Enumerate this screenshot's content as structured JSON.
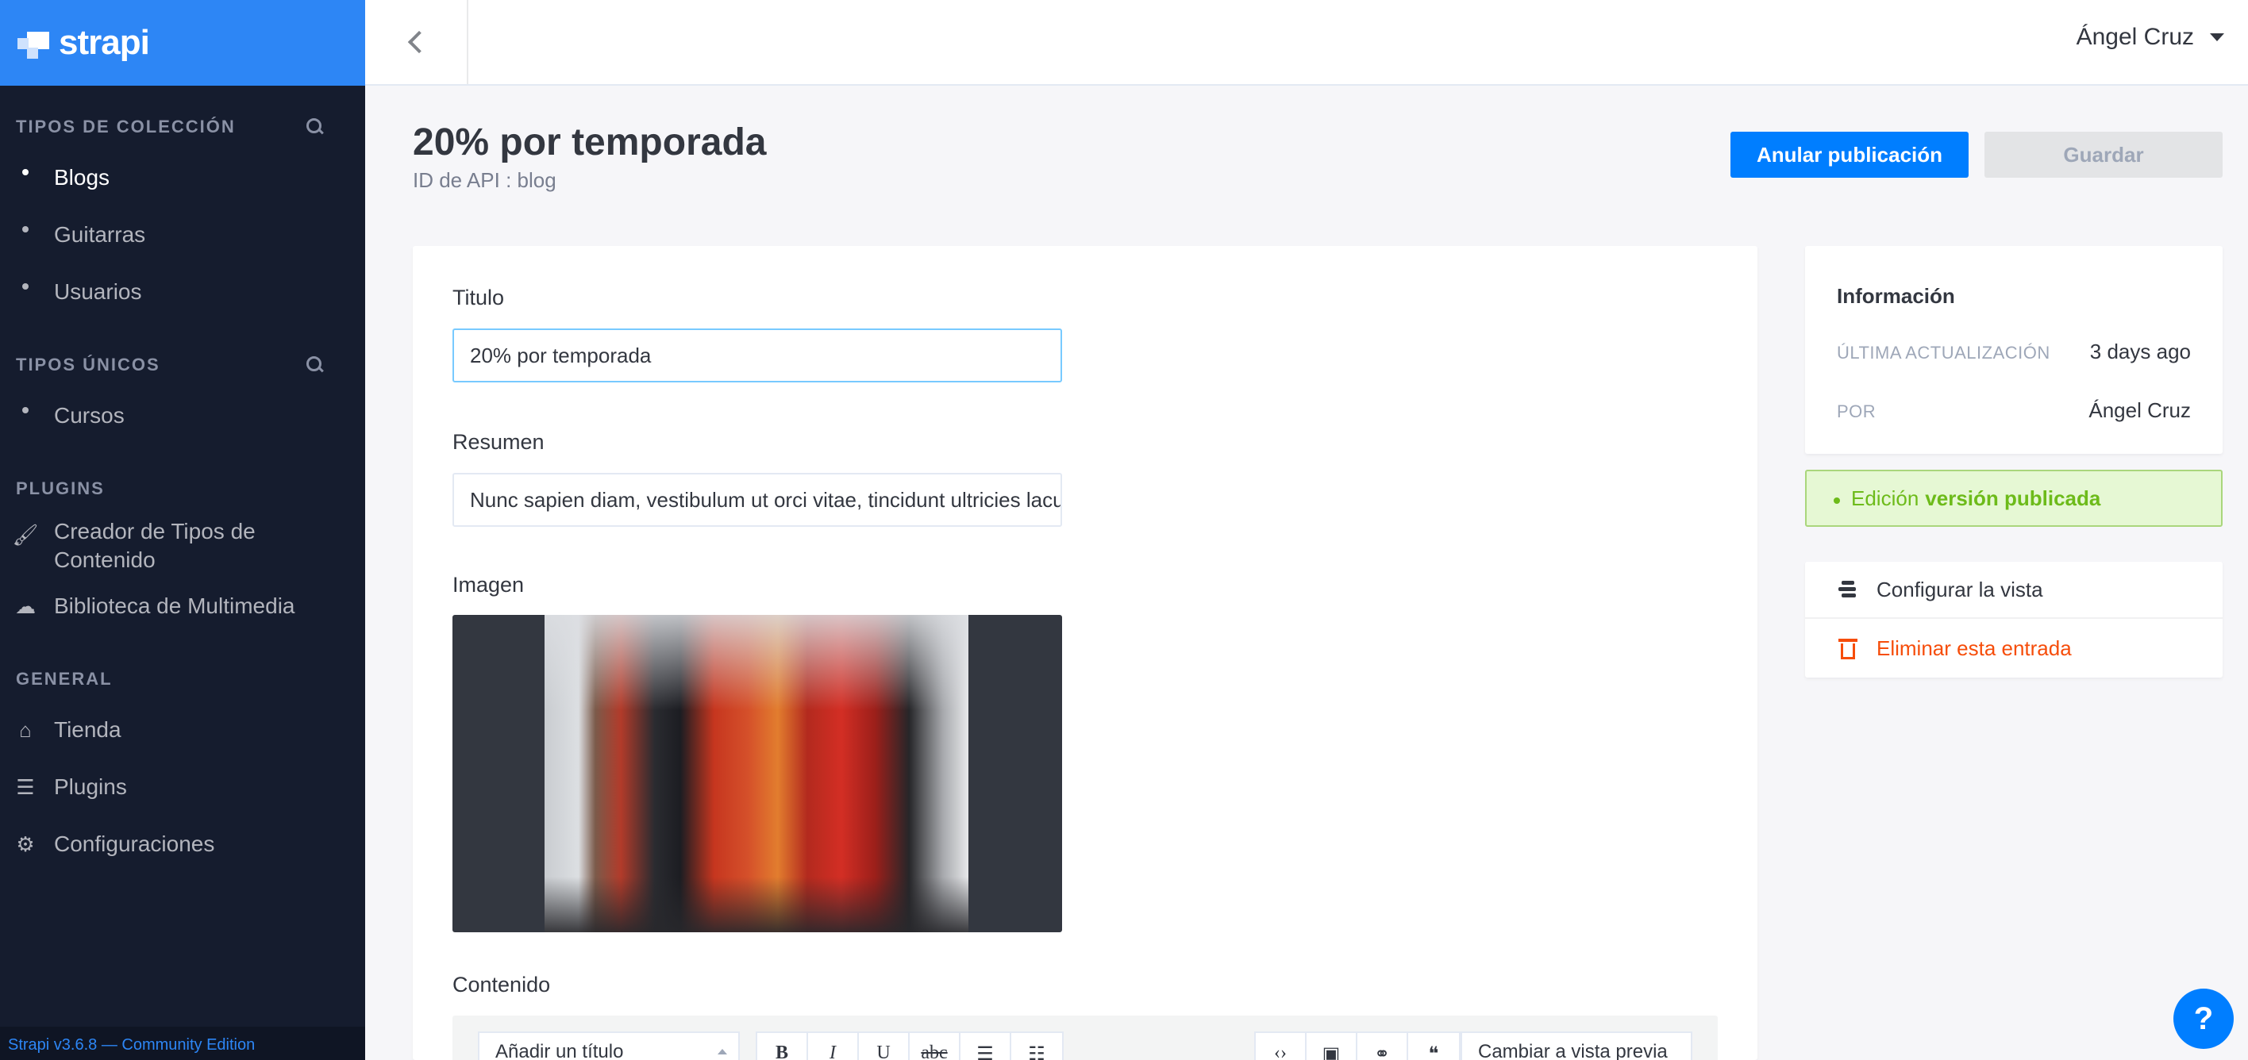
{
  "app": {
    "brand": "strapi",
    "version_footer": "Strapi v3.6.8 — Community Edition"
  },
  "sidebar": {
    "collection_types": {
      "title": "TIPOS DE COLECCIÓN",
      "items": [
        {
          "label": "Blogs",
          "active": true
        },
        {
          "label": "Guitarras",
          "active": false
        },
        {
          "label": "Usuarios",
          "active": false
        }
      ]
    },
    "single_types": {
      "title": "TIPOS ÚNICOS",
      "items": [
        {
          "label": "Cursos"
        }
      ]
    },
    "plugins": {
      "title": "PLUGINS",
      "items": [
        {
          "label": "Creador de Tipos de Contenido",
          "icon": "paintbrush-icon"
        },
        {
          "label": "Biblioteca de Multimedia",
          "icon": "cloud-upload-icon"
        }
      ]
    },
    "general": {
      "title": "GENERAL",
      "items": [
        {
          "label": "Tienda",
          "icon": "basket-icon"
        },
        {
          "label": "Plugins",
          "icon": "list-icon"
        },
        {
          "label": "Configuraciones",
          "icon": "gear-icon"
        }
      ]
    }
  },
  "header": {
    "user": "Ángel Cruz"
  },
  "page": {
    "title": "20% por temporada",
    "api_id": "ID de API : blog",
    "unpublish_label": "Anular publicación",
    "save_label": "Guardar"
  },
  "form": {
    "titulo": {
      "label": "Titulo",
      "value": "20% por temporada"
    },
    "resumen": {
      "label": "Resumen",
      "value": "Nunc sapien diam, vestibulum ut orci vitae, tincidunt ultricies lacus"
    },
    "imagen": {
      "label": "Imagen"
    },
    "contenido": {
      "label": "Contenido",
      "heading_select": "Añadir un título",
      "tools": [
        "B",
        "I",
        "U",
        "abc",
        "ul",
        "ol",
        "code",
        "image",
        "link",
        "quote"
      ],
      "preview_label": "Cambiar a vista previa"
    }
  },
  "info": {
    "title": "Información",
    "last_update_key": "ÚLTIMA ACTUALIZACIÓN",
    "last_update_val": "3 days ago",
    "by_key": "POR",
    "by_val": "Ángel Cruz"
  },
  "status": {
    "prefix": "Edición",
    "bold": "versión publicada"
  },
  "actions": {
    "configure": "Configurar la vista",
    "delete": "Eliminar esta entrada"
  },
  "help": {
    "label": "?"
  },
  "colors": {
    "brand": "#2d86f5",
    "primary": "#007eff",
    "sidebar": "#151c2e",
    "danger": "#f64d0a",
    "success": "#6dbb1a"
  }
}
